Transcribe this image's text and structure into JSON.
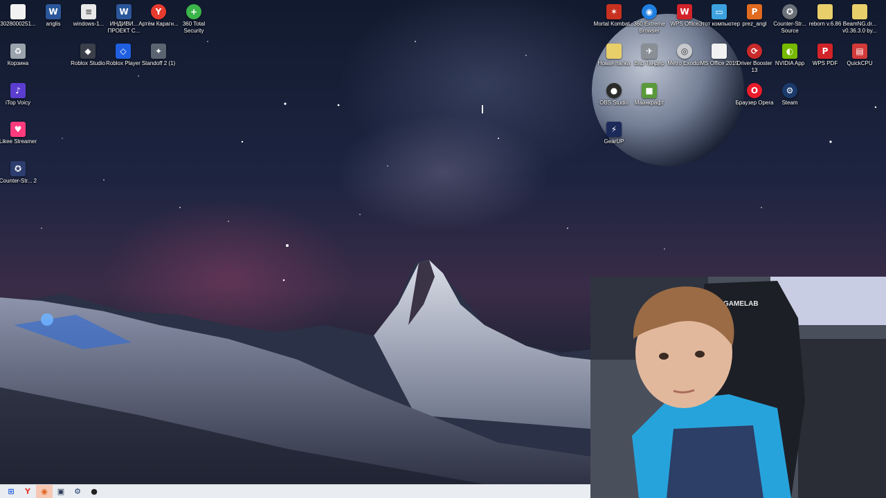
{
  "desktop": {
    "icons": [
      {
        "id": "file-3028",
        "label": "3028000251...",
        "icon": "blank-document-icon",
        "color": "#f2f2f2",
        "glyph": ""
      },
      {
        "id": "anglis",
        "label": "anglis",
        "icon": "word-document-icon",
        "color": "#2b579a",
        "glyph": "W"
      },
      {
        "id": "windows-1",
        "label": "windows-1...",
        "icon": "text-file-icon",
        "color": "#e8e8e8",
        "glyph": "≡"
      },
      {
        "id": "individ",
        "label": "ИНДИВИ... ПРОЕКТ С...",
        "icon": "word-document-icon",
        "color": "#2b579a",
        "glyph": "W"
      },
      {
        "id": "artem",
        "label": "Артём Карагн...",
        "icon": "yandex-browser-icon",
        "color": "#e63b2e",
        "glyph": "Y"
      },
      {
        "id": "360-total",
        "label": "360 Total Security",
        "icon": "360-security-icon",
        "color": "#3bb54a",
        "glyph": "+"
      },
      {
        "id": "recycle",
        "label": "Корзина",
        "icon": "recycle-bin-icon",
        "color": "#9aa3ad",
        "glyph": "♻"
      },
      {
        "id": "roblox-studio",
        "label": "Roblox Studio",
        "icon": "roblox-studio-icon",
        "color": "#3a3f4a",
        "glyph": "◆"
      },
      {
        "id": "roblox-player",
        "label": "Roblox Player",
        "icon": "roblox-player-icon",
        "color": "#1f5fe0",
        "glyph": "◇"
      },
      {
        "id": "standoff",
        "label": "Standoff 2 (1)",
        "icon": "standoff-game-icon",
        "color": "#5a6470",
        "glyph": "✦"
      },
      {
        "id": "itop",
        "label": "iTop Voicy",
        "icon": "itop-voicy-icon",
        "color": "#5b3ed0",
        "glyph": "♪"
      },
      {
        "id": "likee",
        "label": "Likee Streamer",
        "icon": "likee-heart-icon",
        "color": "#ff3b7d",
        "glyph": "♥"
      },
      {
        "id": "cs2",
        "label": "Counter-Str... 2",
        "icon": "counter-strike-icon",
        "color": "#2c3d6e",
        "glyph": "✪"
      },
      {
        "id": "mortal",
        "label": "Mortal Kombat...",
        "icon": "mortal-kombat-icon",
        "color": "#c8311f",
        "glyph": "✶"
      },
      {
        "id": "360-browser",
        "label": "360 Extreme Browser",
        "icon": "360-browser-icon",
        "color": "#1f7fe0",
        "glyph": "◉"
      },
      {
        "id": "wps-office",
        "label": "WPS Office",
        "icon": "wps-office-icon",
        "color": "#d3232a",
        "glyph": "W"
      },
      {
        "id": "this-pc",
        "label": "Этот компьютер",
        "icon": "this-pc-icon",
        "color": "#3da1e0",
        "glyph": "▭"
      },
      {
        "id": "prez",
        "label": "prez_angl",
        "icon": "powerpoint-icon",
        "color": "#e06a1f",
        "glyph": "P"
      },
      {
        "id": "css",
        "label": "Counter-Str... Source",
        "icon": "counter-strike-source-icon",
        "color": "#6a7078",
        "glyph": "✪"
      },
      {
        "id": "reborn",
        "label": "reborn v.6.86",
        "icon": "folder-icon",
        "color": "#e9cf6a",
        "glyph": ""
      },
      {
        "id": "beamng",
        "label": "BeamNG.dr... v0.36.3.0 by...",
        "icon": "folder-icon",
        "color": "#e9cf6a",
        "glyph": ""
      },
      {
        "id": "new-folder",
        "label": "Новая папка",
        "icon": "folder-icon",
        "color": "#e9cf6a",
        "glyph": ""
      },
      {
        "id": "warthunder",
        "label": "Вар Тандер",
        "icon": "war-thunder-icon",
        "color": "#8a8f96",
        "glyph": "✈"
      },
      {
        "id": "metro",
        "label": "Metro Exodus",
        "icon": "metro-exodus-icon",
        "color": "#c7c9cc",
        "glyph": "◎"
      },
      {
        "id": "ms-office",
        "label": "MS Office 2019",
        "icon": "document-icon",
        "color": "#f2f2f2",
        "glyph": ""
      },
      {
        "id": "driver-booster",
        "label": "Driver Booster 13",
        "icon": "driver-booster-icon",
        "color": "#c92a2a",
        "glyph": "⟳"
      },
      {
        "id": "nvidia",
        "label": "NVIDIA App",
        "icon": "nvidia-icon",
        "color": "#76b900",
        "glyph": "◐"
      },
      {
        "id": "wps-pdf",
        "label": "WPS PDF",
        "icon": "wps-pdf-icon",
        "color": "#d3232a",
        "glyph": "P"
      },
      {
        "id": "quickcpu",
        "label": "QuickCPU",
        "icon": "quickcpu-icon",
        "color": "#d23a3a",
        "glyph": "▤"
      },
      {
        "id": "obs",
        "label": "OBS Studio",
        "icon": "obs-studio-icon",
        "color": "#2b2b2b",
        "glyph": "●"
      },
      {
        "id": "minecraft",
        "label": "Майнкрафт",
        "icon": "minecraft-icon",
        "color": "#5a9a3a",
        "glyph": "■"
      },
      {
        "id": "opera",
        "label": "Браузер Opera",
        "icon": "opera-browser-icon",
        "color": "#ea1c2c",
        "glyph": "O"
      },
      {
        "id": "steam",
        "label": "Steam",
        "icon": "steam-icon",
        "color": "#1b3a6b",
        "glyph": "⚙"
      },
      {
        "id": "gearup",
        "label": "GearUP",
        "icon": "gearup-icon",
        "color": "#1c2a5a",
        "glyph": "⚡"
      }
    ]
  },
  "taskbar": {
    "buttons": [
      {
        "id": "start",
        "icon": "windows-start-icon",
        "glyph": "⊞",
        "color": "#1f5fe0",
        "active": false
      },
      {
        "id": "yandex",
        "icon": "yandex-browser-icon",
        "glyph": "Y",
        "color": "#e63b2e",
        "active": false
      },
      {
        "id": "orange-app",
        "icon": "app-icon",
        "glyph": "◉",
        "color": "#e0641f",
        "active": true
      },
      {
        "id": "app-4",
        "icon": "app-icon",
        "glyph": "▣",
        "color": "#2b3a55",
        "active": false
      },
      {
        "id": "steam",
        "icon": "steam-icon",
        "glyph": "⚙",
        "color": "#1b3a6b",
        "active": false
      },
      {
        "id": "obs",
        "icon": "obs-studio-icon",
        "glyph": "●",
        "color": "#222222",
        "active": false
      }
    ]
  },
  "webcam": {
    "chair_brand": "GAMELAB"
  }
}
